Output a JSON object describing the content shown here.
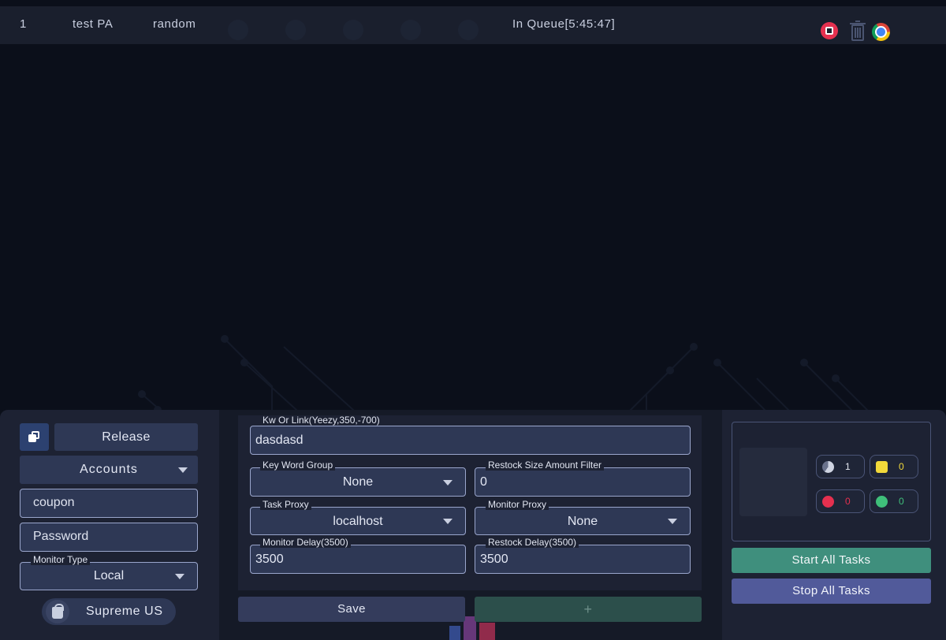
{
  "task": {
    "id": "1",
    "name": "test PA",
    "size": "random",
    "status": "In Queue[5:45:47]"
  },
  "icons": {
    "stop": "stop-circle-icon",
    "trash": "trash-icon",
    "browser": "chrome-icon",
    "copy": "copy-icon",
    "store": "shopify-bag-icon"
  },
  "left": {
    "mode_button": "Release",
    "accounts_select": "Accounts",
    "coupon_placeholder": "coupon",
    "password_placeholder": "Password",
    "monitor_type_label": "Monitor Type",
    "monitor_type_value": "Local",
    "store_name": "Supreme US"
  },
  "form": {
    "kw_label": "Kw Or Link(Yeezy,350,-700)",
    "kw_value": "dasdasd",
    "keyword_group_label": "Key Word Group",
    "keyword_group_value": "None",
    "restock_filter_label": "Restock Size Amount Filter",
    "restock_filter_value": "0",
    "task_proxy_label": "Task Proxy",
    "task_proxy_value": "localhost",
    "monitor_proxy_label": "Monitor Proxy",
    "monitor_proxy_value": "None",
    "monitor_delay_label": "Monitor Delay(3500)",
    "monitor_delay_value": "3500",
    "restock_delay_label": "Restock Delay(3500)",
    "restock_delay_value": "3500",
    "save_label": "Save",
    "add_label": "+"
  },
  "stats": {
    "running": "1",
    "carted": "0",
    "failed": "0",
    "success": "0"
  },
  "actions": {
    "start_all": "Start All Tasks",
    "stop_all": "Stop All Tasks"
  },
  "colors": {
    "background": "#0b0f1a",
    "row": "#1a1f2d",
    "accent_status": "#8fb0ff",
    "stop": "#e5304f",
    "start_green": "#3f8f7d",
    "stop_purple": "#515a9a",
    "cart_yellow": "#f2d93a",
    "fail_red": "#e5304f",
    "success_green": "#3fbf7a"
  }
}
